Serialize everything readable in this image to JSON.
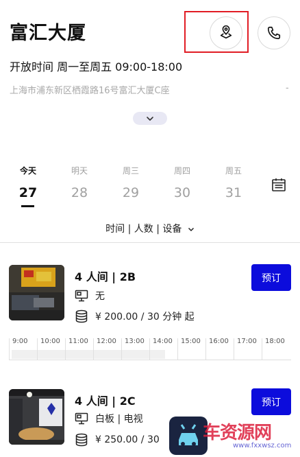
{
  "header": {
    "title": "富汇大厦"
  },
  "info": {
    "hours": "开放时间 周一至周五 09:00-18:00",
    "address": "上海市浦东新区栖霞路16号富汇大厦C座",
    "address_trailing": "-"
  },
  "dates": [
    {
      "dow": "今天",
      "num": "27"
    },
    {
      "dow": "明天",
      "num": "28"
    },
    {
      "dow": "周三",
      "num": "29"
    },
    {
      "dow": "周四",
      "num": "30"
    },
    {
      "dow": "周五",
      "num": "31"
    }
  ],
  "filter": {
    "label": "时间 | 人数 | 设备"
  },
  "rooms": [
    {
      "title": "4 人间 | 2B",
      "equipment": "无",
      "price": "¥ 200.00 / 30 分钟 起",
      "book_label": "预订"
    },
    {
      "title": "4 人间 | 2C",
      "equipment": "白板 | 电视",
      "price": "¥ 250.00 / 30",
      "book_label": "预订"
    }
  ],
  "timeline": {
    "ticks": [
      "9:00",
      "10:00",
      "11:00",
      "12:00",
      "13:00",
      "14:00",
      "15:00",
      "16:00",
      "17:00",
      "18:00"
    ]
  },
  "watermark": {
    "text": "车资源网",
    "url": "www.fxxwsz.com"
  },
  "colors": {
    "accent": "#0c0cdc",
    "highlight": "#e11c24",
    "muted": "#a8a8a8"
  },
  "icons": [
    "map-pin-icon",
    "phone-icon",
    "chevron-down-icon",
    "calendar-icon",
    "monitor-icon",
    "coins-icon"
  ]
}
